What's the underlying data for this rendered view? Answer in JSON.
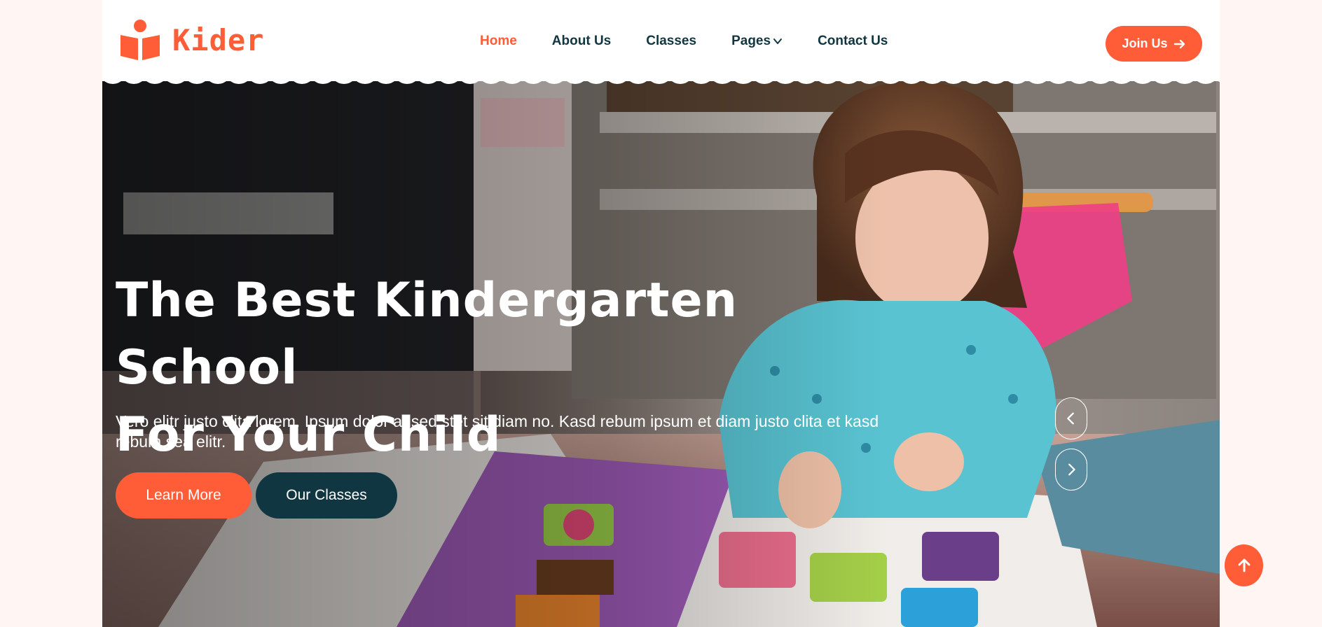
{
  "brand": {
    "name": "Kider",
    "icon": "book-reader-icon",
    "color": "#fe5d37"
  },
  "nav": {
    "items": [
      {
        "label": "Home",
        "active": true
      },
      {
        "label": "About Us",
        "active": false
      },
      {
        "label": "Classes",
        "active": false
      },
      {
        "label": "Pages",
        "active": false,
        "has_dropdown": true
      },
      {
        "label": "Contact Us",
        "active": false
      }
    ],
    "join_label": "Join Us"
  },
  "hero": {
    "title_line1": "The Best Kindergarten School",
    "title_line2": "For Your Child",
    "text": "Vero elitr justo clita lorem. Ipsum dolor at sed stet sit diam no. Kasd rebum ipsum et diam justo clita et kasd rebum sea elitr.",
    "learn_more_label": "Learn More",
    "our_classes_label": "Our Classes"
  },
  "carousel": {
    "prev_icon": "chevron-left-icon",
    "next_icon": "chevron-right-icon"
  },
  "back_to_top_icon": "arrow-up-icon",
  "colors": {
    "primary": "#fe5d37",
    "dark": "#103741",
    "page_bg": "#fff5f3"
  }
}
